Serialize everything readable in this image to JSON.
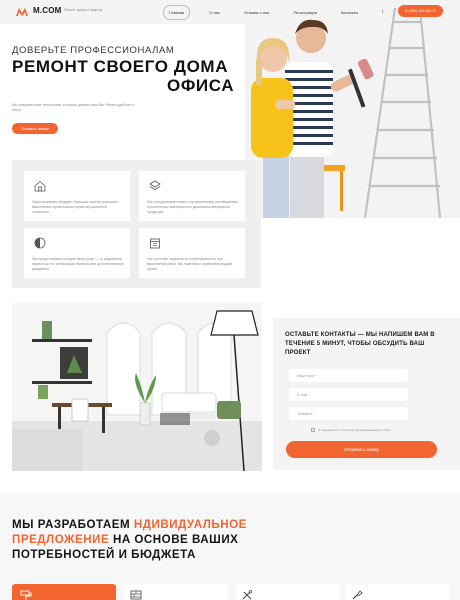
{
  "header": {
    "logo": "M.COM",
    "tagline": "Ремонт домов и квартир",
    "nav": [
      "Главная",
      "О нас",
      "Отзывы о нас",
      "Регистрация",
      "Контакты"
    ],
    "nav_extra_icon": "info-icon",
    "phone": "8 (000) 000-00-00"
  },
  "hero": {
    "subtitle": "Доверьте профессионалам",
    "title_line1": "Ремонт своего дома",
    "title_line2": "офиса",
    "text": "Мы современные технологии, которые делают ваш Бит Ремон удобнее и легче.",
    "button": "Оставить заявку"
  },
  "features": [
    {
      "icon": "home-icon",
      "text": "Наша компания обладает большим опытом успешного выполнения строительных проектов различной сложности"
    },
    {
      "icon": "layers-icon",
      "text": "Мы сотрудничаем только с проверенными поставщиками строительных материалов и дешевизна материалов продукции"
    },
    {
      "icon": "half-circle-icon",
      "text": "Мы предоставляем полную смету услуг — от разработки проекта до его реализации, включая все дополнительные документы"
    },
    {
      "icon": "calendar-icon",
      "text": "Нас отличает надёжность и пунктуальность при выполнении работ. Мы тщательно проверяем каждый проект"
    }
  ],
  "form": {
    "title": "Оставьте контакты — мы напишем вам в течение 5 минут, чтобы обсудить ваш проект",
    "name_placeholder": "Ваше имя *",
    "email_placeholder": "E-mail",
    "phone_placeholder": "Телефон *",
    "consent": "Я ознакомился с политикой конфиденциальности сайта",
    "button": "Отправить заявку"
  },
  "offer": {
    "title_part1": "Мы разработаем ",
    "title_highlight": "ндивидуальное предложение",
    "title_part2": " на основе ваших потребностей и бюджета"
  },
  "services": [
    {
      "icon": "paint-roller-icon"
    },
    {
      "icon": "brick-wall-icon"
    },
    {
      "icon": "tools-icon"
    },
    {
      "icon": "brush-icon"
    }
  ],
  "colors": {
    "accent": "#f26430",
    "panel": "#efefef"
  }
}
